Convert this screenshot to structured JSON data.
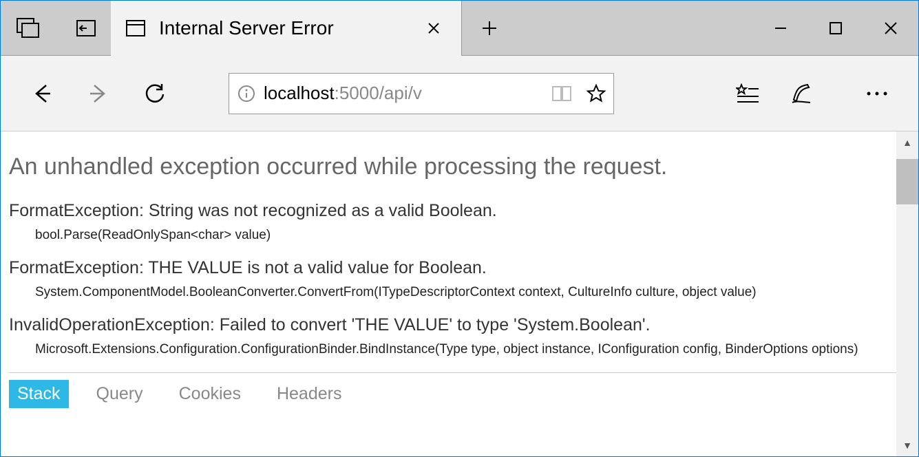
{
  "browser": {
    "tab_title": "Internal Server Error",
    "address_host": "localhost",
    "address_rest": ":5000/api/v"
  },
  "page": {
    "heading": "An unhandled exception occurred while processing the request.",
    "exceptions": [
      {
        "head": "FormatException: String was not recognized as a valid Boolean.",
        "trace": "bool.Parse(ReadOnlySpan<char> value)"
      },
      {
        "head": "FormatException: THE VALUE is not a valid value for Boolean.",
        "trace": "System.ComponentModel.BooleanConverter.ConvertFrom(ITypeDescriptorContext context, CultureInfo culture, object value)"
      },
      {
        "head": "InvalidOperationException: Failed to convert 'THE VALUE' to type 'System.Boolean'.",
        "trace": "Microsoft.Extensions.Configuration.ConfigurationBinder.BindInstance(Type type, object instance, IConfiguration config, BinderOptions options)"
      }
    ],
    "tabs": {
      "stack": "Stack",
      "query": "Query",
      "cookies": "Cookies",
      "headers": "Headers"
    }
  }
}
